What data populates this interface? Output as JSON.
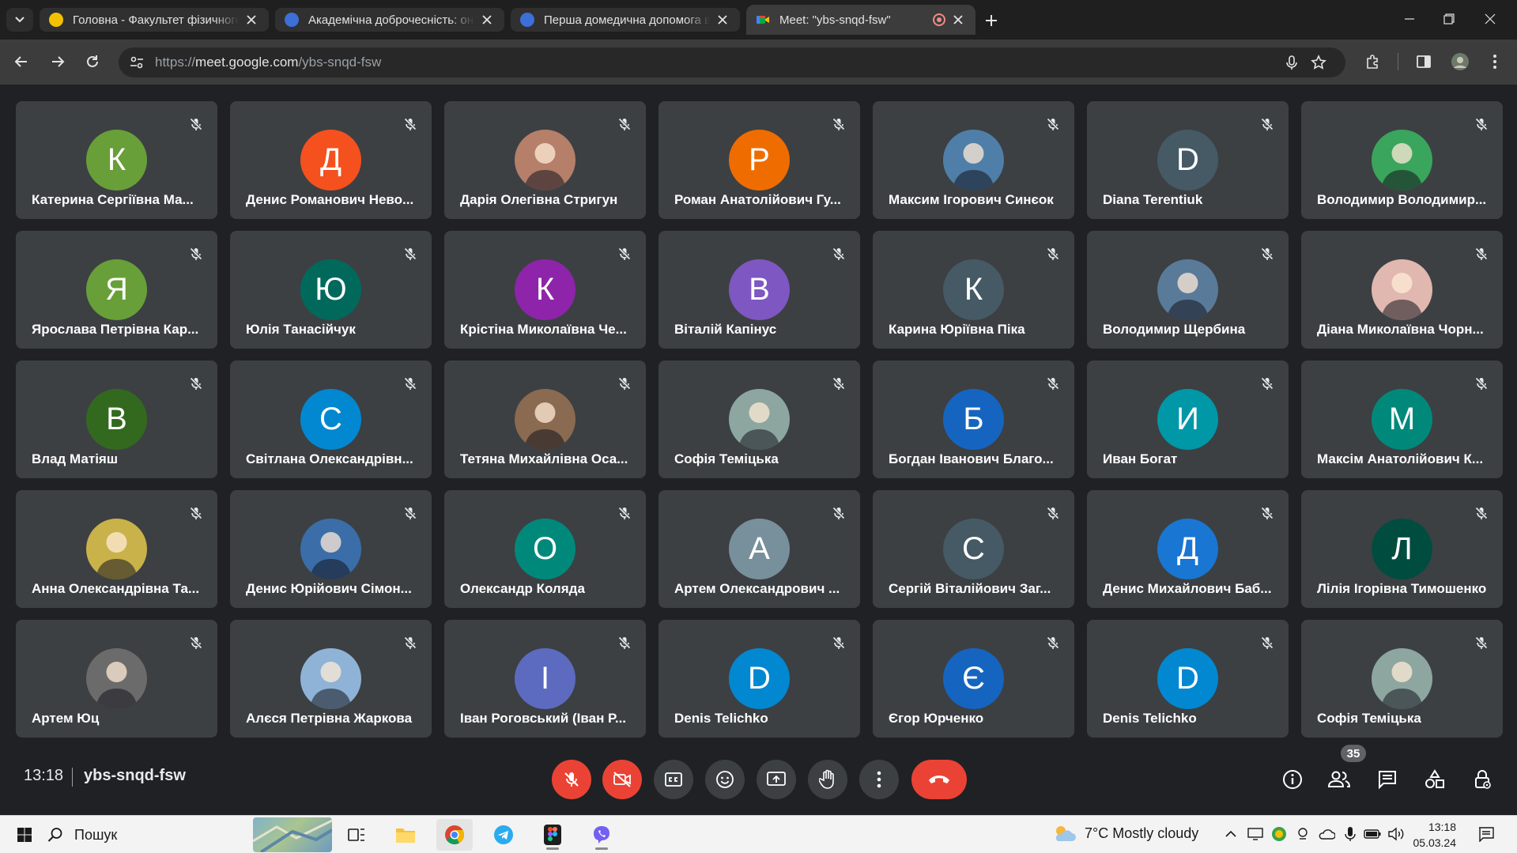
{
  "browser": {
    "tabs": [
      {
        "title": "Головна - Факультет фізичного",
        "favicon_color": "#f2c200",
        "active": false
      },
      {
        "title": "Академічна доброчесність: он",
        "favicon_color": "#3d6fd8",
        "active": false
      },
      {
        "title": "Перша домедична допомога в",
        "favicon_color": "#3d6fd8",
        "active": false
      },
      {
        "title": "Meet: \"ybs-snqd-fsw\"",
        "favicon_color": "#00ac47",
        "active": true,
        "recording": true
      }
    ],
    "url_scheme": "https://",
    "url_host": "meet.google.com",
    "url_path": "/ybs-snqd-fsw"
  },
  "meet": {
    "participants": [
      {
        "name": "Катерина Сергіївна Ма...",
        "initial": "К",
        "color": "#689f38",
        "photo": false
      },
      {
        "name": "Денис Романович Нево...",
        "initial": "Д",
        "color": "#f4511e",
        "photo": false
      },
      {
        "name": "Дарія Олегівна Стригун",
        "initial": "",
        "color": "#b57f6a",
        "photo": true
      },
      {
        "name": "Роман Анатолійович Гу...",
        "initial": "Р",
        "color": "#ef6c00",
        "photo": false
      },
      {
        "name": "Максим Ігорович Синєок",
        "initial": "",
        "color": "#4f7fa8",
        "photo": true
      },
      {
        "name": "Diana Terentiuk",
        "initial": "D",
        "color": "#455a64",
        "photo": false
      },
      {
        "name": "Володимир Володимир...",
        "initial": "",
        "color": "#3aa55c",
        "photo": true
      },
      {
        "name": "Ярослава Петрівна Кар...",
        "initial": "Я",
        "color": "#689f38",
        "photo": false
      },
      {
        "name": "Юлія Танасійчук",
        "initial": "Ю",
        "color": "#00695c",
        "photo": false
      },
      {
        "name": "Крістіна Миколаївна Че...",
        "initial": "К",
        "color": "#8e24aa",
        "photo": false
      },
      {
        "name": "Віталій Капінус",
        "initial": "В",
        "color": "#7e57c2",
        "photo": false
      },
      {
        "name": "Карина Юріївна Піка",
        "initial": "К",
        "color": "#455a64",
        "photo": false
      },
      {
        "name": "Володимир Щербина",
        "initial": "",
        "color": "#5a7a9a",
        "photo": true
      },
      {
        "name": "Діана Миколаївна Чорн...",
        "initial": "",
        "color": "#e0b8b0",
        "photo": true
      },
      {
        "name": "Влад Матіяш",
        "initial": "В",
        "color": "#33691e",
        "photo": false
      },
      {
        "name": "Світлана Олександрівн...",
        "initial": "С",
        "color": "#0288d1",
        "photo": false
      },
      {
        "name": "Тетяна Михайлівна Оса...",
        "initial": "",
        "color": "#8a6a50",
        "photo": true
      },
      {
        "name": "Софія Теміцька",
        "initial": "",
        "color": "#8da6a0",
        "photo": true
      },
      {
        "name": "Богдан Іванович Благо...",
        "initial": "Б",
        "color": "#1565c0",
        "photo": false
      },
      {
        "name": "Иван Богат",
        "initial": "И",
        "color": "#0097a7",
        "photo": false
      },
      {
        "name": "Максім Анатолійович К...",
        "initial": "М",
        "color": "#00897b",
        "photo": false
      },
      {
        "name": "Анна Олександрівна Та...",
        "initial": "",
        "color": "#c9b24a",
        "photo": true
      },
      {
        "name": "Денис Юрійович Сімон...",
        "initial": "",
        "color": "#3b6ea8",
        "photo": true
      },
      {
        "name": "Олександр Коляда",
        "initial": "О",
        "color": "#00897b",
        "photo": false
      },
      {
        "name": "Артем Олександрович ...",
        "initial": "А",
        "color": "#78909c",
        "photo": false
      },
      {
        "name": "Сергій Віталійович Заг...",
        "initial": "С",
        "color": "#455a64",
        "photo": false
      },
      {
        "name": "Денис Михайлович Баб...",
        "initial": "Д",
        "color": "#1976d2",
        "photo": false
      },
      {
        "name": "Лілія Ігорівна Тимошенко",
        "initial": "Л",
        "color": "#004d40",
        "photo": false
      },
      {
        "name": "Артем Юц",
        "initial": "",
        "color": "#6b6b6b",
        "photo": true
      },
      {
        "name": "Алєся Петрівна Жаркова",
        "initial": "",
        "color": "#8fb3d6",
        "photo": true
      },
      {
        "name": "Іван Роговський (Іван Р...",
        "initial": "І",
        "color": "#5c6bc0",
        "photo": false
      },
      {
        "name": "Denis Telichko",
        "initial": "D",
        "color": "#0288d1",
        "photo": false
      },
      {
        "name": "Єгор Юрченко",
        "initial": "Є",
        "color": "#1565c0",
        "photo": false
      },
      {
        "name": "Denis Telichko",
        "initial": "D",
        "color": "#0288d1",
        "photo": false
      },
      {
        "name": "Софія Теміцька",
        "initial": "",
        "color": "#8da6a0",
        "photo": true
      }
    ],
    "time": "13:18",
    "meeting_code": "ybs-snqd-fsw",
    "people_count": "35"
  },
  "taskbar": {
    "search_label": "Пошук",
    "weather": "7°C  Mostly cloudy",
    "time": "13:18",
    "date": "05.03.24"
  }
}
